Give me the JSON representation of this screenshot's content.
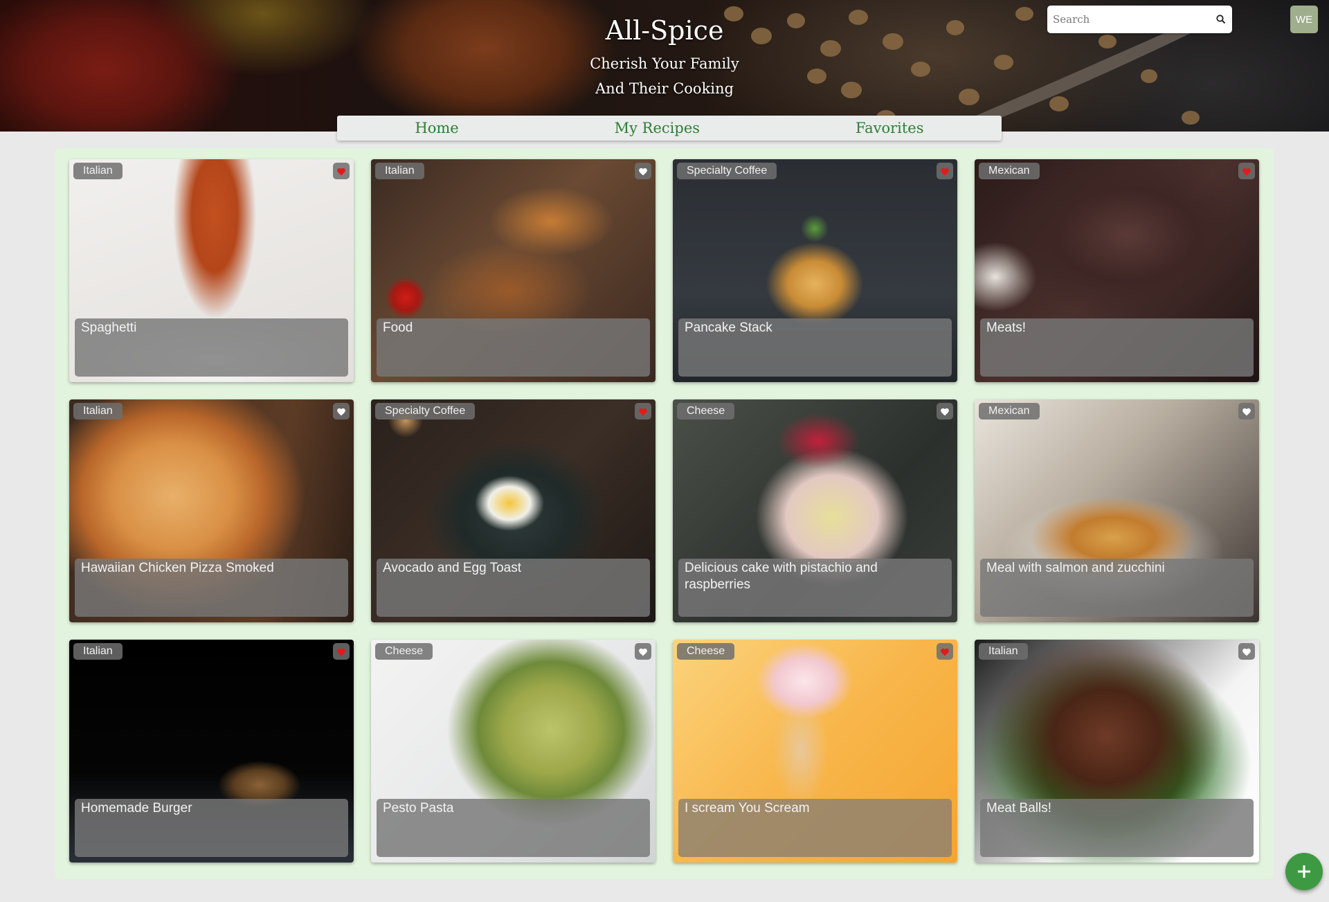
{
  "header": {
    "title": "All-Spice",
    "subtitle_line1": "Cherish Your Family",
    "subtitle_line2": "And Their Cooking"
  },
  "search": {
    "placeholder": "Search",
    "value": "",
    "icon": "search-icon"
  },
  "account": {
    "initials": "WE",
    "color": "#9fae8c"
  },
  "nav": {
    "home": "Home",
    "my_recipes": "My Recipes",
    "favorites": "Favorites"
  },
  "colors": {
    "accent": "#2e7d32",
    "panel": "#e2f4de",
    "favorite_active": "#e01b1b",
    "favorite_inactive": "#ffffff"
  },
  "recipes": [
    {
      "title": "Spaghetti",
      "category": "Italian",
      "favorited": true
    },
    {
      "title": "Food",
      "category": "Italian",
      "favorited": false
    },
    {
      "title": "Pancake Stack",
      "category": "Specialty Coffee",
      "favorited": true
    },
    {
      "title": "Meats!",
      "category": "Mexican",
      "favorited": true
    },
    {
      "title": "Hawaiian Chicken Pizza Smoked",
      "category": "Italian",
      "favorited": false
    },
    {
      "title": "Avocado and Egg Toast",
      "category": "Specialty Coffee",
      "favorited": true
    },
    {
      "title": "Delicious cake with pistachio and raspberries",
      "category": "Cheese",
      "favorited": false
    },
    {
      "title": "Meal with salmon and zucchini",
      "category": "Mexican",
      "favorited": false
    },
    {
      "title": "Homemade Burger",
      "category": "Italian",
      "favorited": true
    },
    {
      "title": "Pesto Pasta",
      "category": "Cheese",
      "favorited": false
    },
    {
      "title": "I scream You Scream",
      "category": "Cheese",
      "favorited": true
    },
    {
      "title": "Meat Balls!",
      "category": "Italian",
      "favorited": false
    }
  ],
  "add_button": {
    "icon": "plus-icon"
  }
}
